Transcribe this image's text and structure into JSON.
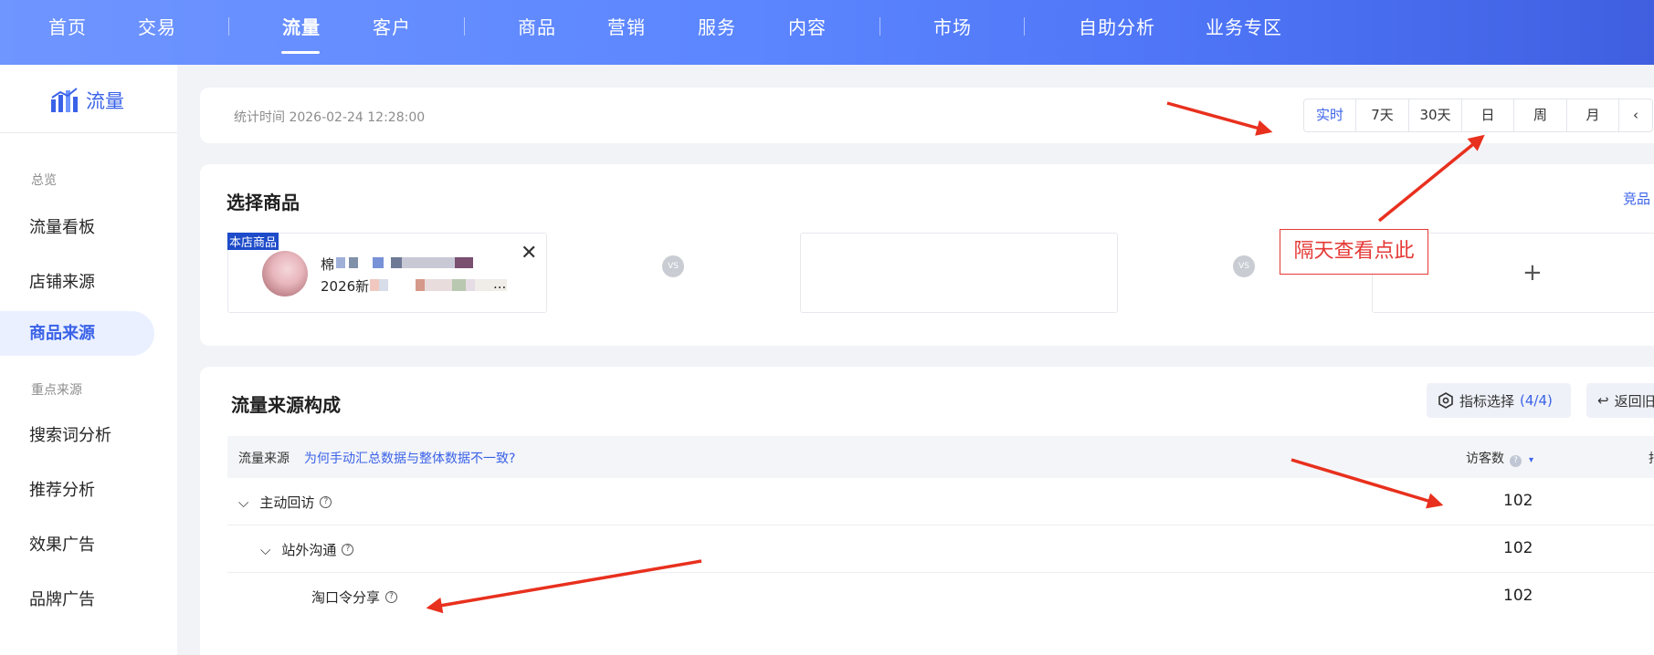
{
  "topnav": {
    "items": [
      {
        "label": "首页"
      },
      {
        "label": "交易"
      },
      {
        "label": "流量"
      },
      {
        "label": "客户"
      },
      {
        "label": "商品"
      },
      {
        "label": "营销"
      },
      {
        "label": "服务"
      },
      {
        "label": "内容"
      },
      {
        "label": "市场"
      },
      {
        "label": "自助分析"
      },
      {
        "label": "业务专区"
      }
    ],
    "active": "流量"
  },
  "sidebar": {
    "brand": "流量",
    "section_overview": "总览",
    "items_overview": [
      {
        "label": "流量看板"
      },
      {
        "label": "店铺来源"
      },
      {
        "label": "商品来源"
      }
    ],
    "section_key": "重点来源",
    "items_key": [
      {
        "label": "搜索词分析"
      },
      {
        "label": "推荐分析"
      },
      {
        "label": "效果广告"
      },
      {
        "label": "品牌广告"
      }
    ],
    "active": "商品来源"
  },
  "stat_bar": {
    "time": "统计时间 2026-02-24 12:28:00",
    "periods": [
      {
        "label": "实时"
      },
      {
        "label": "7天"
      },
      {
        "label": "30天"
      },
      {
        "label": "日"
      },
      {
        "label": "周"
      },
      {
        "label": "月"
      },
      {
        "label": "‹"
      }
    ],
    "active_period": "实时"
  },
  "select_product": {
    "title": "选择商品",
    "compare_link": "竞品",
    "tag": "本店商品",
    "product_line1": "棉",
    "product_line2": "2026新",
    "product_ellipsis": "...",
    "close": "✕",
    "vs": "VS",
    "plus": "+"
  },
  "traffic": {
    "title": "流量来源构成",
    "metric_button": "指标选择",
    "metric_count": "(4/4)",
    "return_button": "返回旧",
    "header_source": "流量来源",
    "header_link": "为何手动汇总数据与整体数据不一致?",
    "header_visitors": "访客数",
    "header_more": "指",
    "rows": [
      {
        "name": "主动回访",
        "value": "102"
      },
      {
        "name": "站外沟通",
        "value": "102"
      },
      {
        "name": "淘口令分享",
        "value": "102"
      }
    ]
  },
  "annotation": "隔天查看点此",
  "colors": {
    "accent": "#3a62e8",
    "annotation_red": "#e53935",
    "nav_gradient_start": "#6f95ff"
  }
}
